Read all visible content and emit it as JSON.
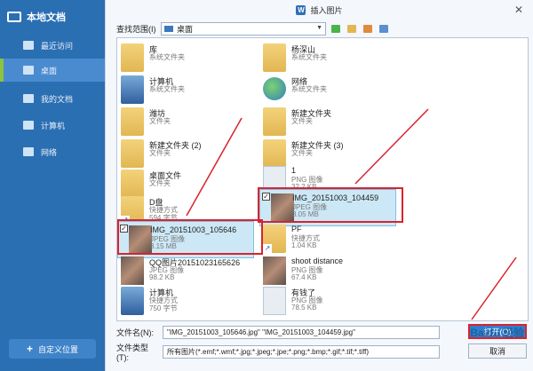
{
  "sidebar": {
    "title": "本地文档",
    "items": [
      {
        "label": "最近访问",
        "icon": "clock-icon"
      },
      {
        "label": "桌面",
        "icon": "desktop-icon"
      },
      {
        "label": "我的文档",
        "icon": "folder-icon"
      },
      {
        "label": "计算机",
        "icon": "computer-icon"
      },
      {
        "label": "网络",
        "icon": "network-icon"
      }
    ],
    "add_location": "自定义位置"
  },
  "dialog": {
    "title": "插入图片",
    "close": "✕",
    "lookin_label": "查找范围(I)",
    "lookin_value": "桌面"
  },
  "files": {
    "col1": [
      {
        "name": "库",
        "type": "系统文件夹",
        "size": ""
      },
      {
        "name": "计算机",
        "type": "系统文件夹",
        "size": ""
      },
      {
        "name": "潍坊",
        "type": "文件夹",
        "size": ""
      },
      {
        "name": "新建文件夹 (2)",
        "type": "文件夹",
        "size": ""
      },
      {
        "name": "桌面文件",
        "type": "文件夹",
        "size": ""
      },
      {
        "name": "D盘",
        "type": "快捷方式",
        "size": "594 字节"
      },
      {
        "name": "IMG_20151003_105646",
        "type": "JPEG 图像",
        "size": "3.15 MB"
      },
      {
        "name": "QQ图片20151023165626",
        "type": "JPEG 图像",
        "size": "98.2 KB"
      },
      {
        "name": "计算机",
        "type": "快捷方式",
        "size": "750 字节"
      }
    ],
    "col2": [
      {
        "name": "杨深山",
        "type": "系统文件夹",
        "size": ""
      },
      {
        "name": "网络",
        "type": "系统文件夹",
        "size": ""
      },
      {
        "name": "新建文件夹",
        "type": "文件夹",
        "size": ""
      },
      {
        "name": "新建文件夹 (3)",
        "type": "文件夹",
        "size": ""
      },
      {
        "name": "1",
        "type": "PNG 图像",
        "size": "32.2 KB"
      },
      {
        "name": "IMG_20151003_104459",
        "type": "JPEG 图像",
        "size": "3.05 MB"
      },
      {
        "name": "PF",
        "type": "快捷方式",
        "size": "1.04 KB"
      },
      {
        "name": "shoot distance",
        "type": "PNG 图像",
        "size": "67.4 KB"
      },
      {
        "name": "有钱了",
        "type": "PNG 图像",
        "size": "78.5 KB"
      }
    ]
  },
  "bottom": {
    "filename_label": "文件名(N):",
    "filename_value": "\"IMG_20151003_105646.jpg\" \"IMG_20151003_104459.jpg\"",
    "filetype_label": "文件类型(T):",
    "filetype_value": "所有图片(*.emf;*.wmf;*.jpg;*.jpeg;*.jpe;*.png;*.bmp;*.gif;*.tif;*.tiff)",
    "open_button": "打开(O)",
    "cancel_button": "取消"
  },
  "watermark": "Baidu 经验",
  "colors": {
    "sidebar": "#2b6fb3",
    "accent": "#8cc33f",
    "selection": "#cce8f6",
    "annotation": "#d9232d"
  }
}
